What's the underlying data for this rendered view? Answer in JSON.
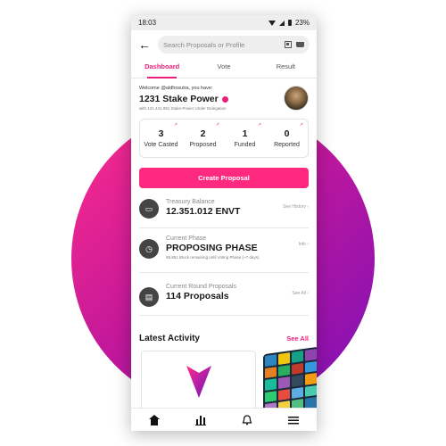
{
  "status_bar": {
    "time": "18:03",
    "battery": "23%"
  },
  "search": {
    "placeholder": "Search Proposals or Profile"
  },
  "tabs": [
    {
      "label": "Dashboard",
      "active": true
    },
    {
      "label": "Vote",
      "active": false
    },
    {
      "label": "Result",
      "active": false
    }
  ],
  "profile": {
    "welcome": "Welcome @aldhosutra, you have:",
    "stake_power": "1231 Stake Power",
    "delegation": "with 121.431.091 Stake-Power Under Delegation"
  },
  "stats": [
    {
      "value": "3",
      "label": "Vote Casted"
    },
    {
      "value": "2",
      "label": "Proposed"
    },
    {
      "value": "1",
      "label": "Funded"
    },
    {
      "value": "0",
      "label": "Reported"
    }
  ],
  "create_button": "Create Proposal",
  "treasury": {
    "label": "Treasury Balance",
    "value": "12.351.012 ENVT",
    "link": "See History ›"
  },
  "phase": {
    "label": "Current Phase",
    "value": "PROPOSING PHASE",
    "sub": "65.851 Block remaining until Voting Phase (~7 days)",
    "link": "Info ›"
  },
  "round": {
    "label": "Current Round Proposals",
    "value": "114 Proposals",
    "link": "See All ›"
  },
  "latest": {
    "title": "Latest Activity",
    "see_all": "See All"
  },
  "colors": {
    "accent": "#e91e7a",
    "button": "#ff2a7f",
    "gradient_start": "#ff2d8a",
    "gradient_end": "#7a10b8"
  },
  "nav": [
    "home-icon",
    "chart-icon",
    "bell-icon",
    "menu-icon"
  ]
}
